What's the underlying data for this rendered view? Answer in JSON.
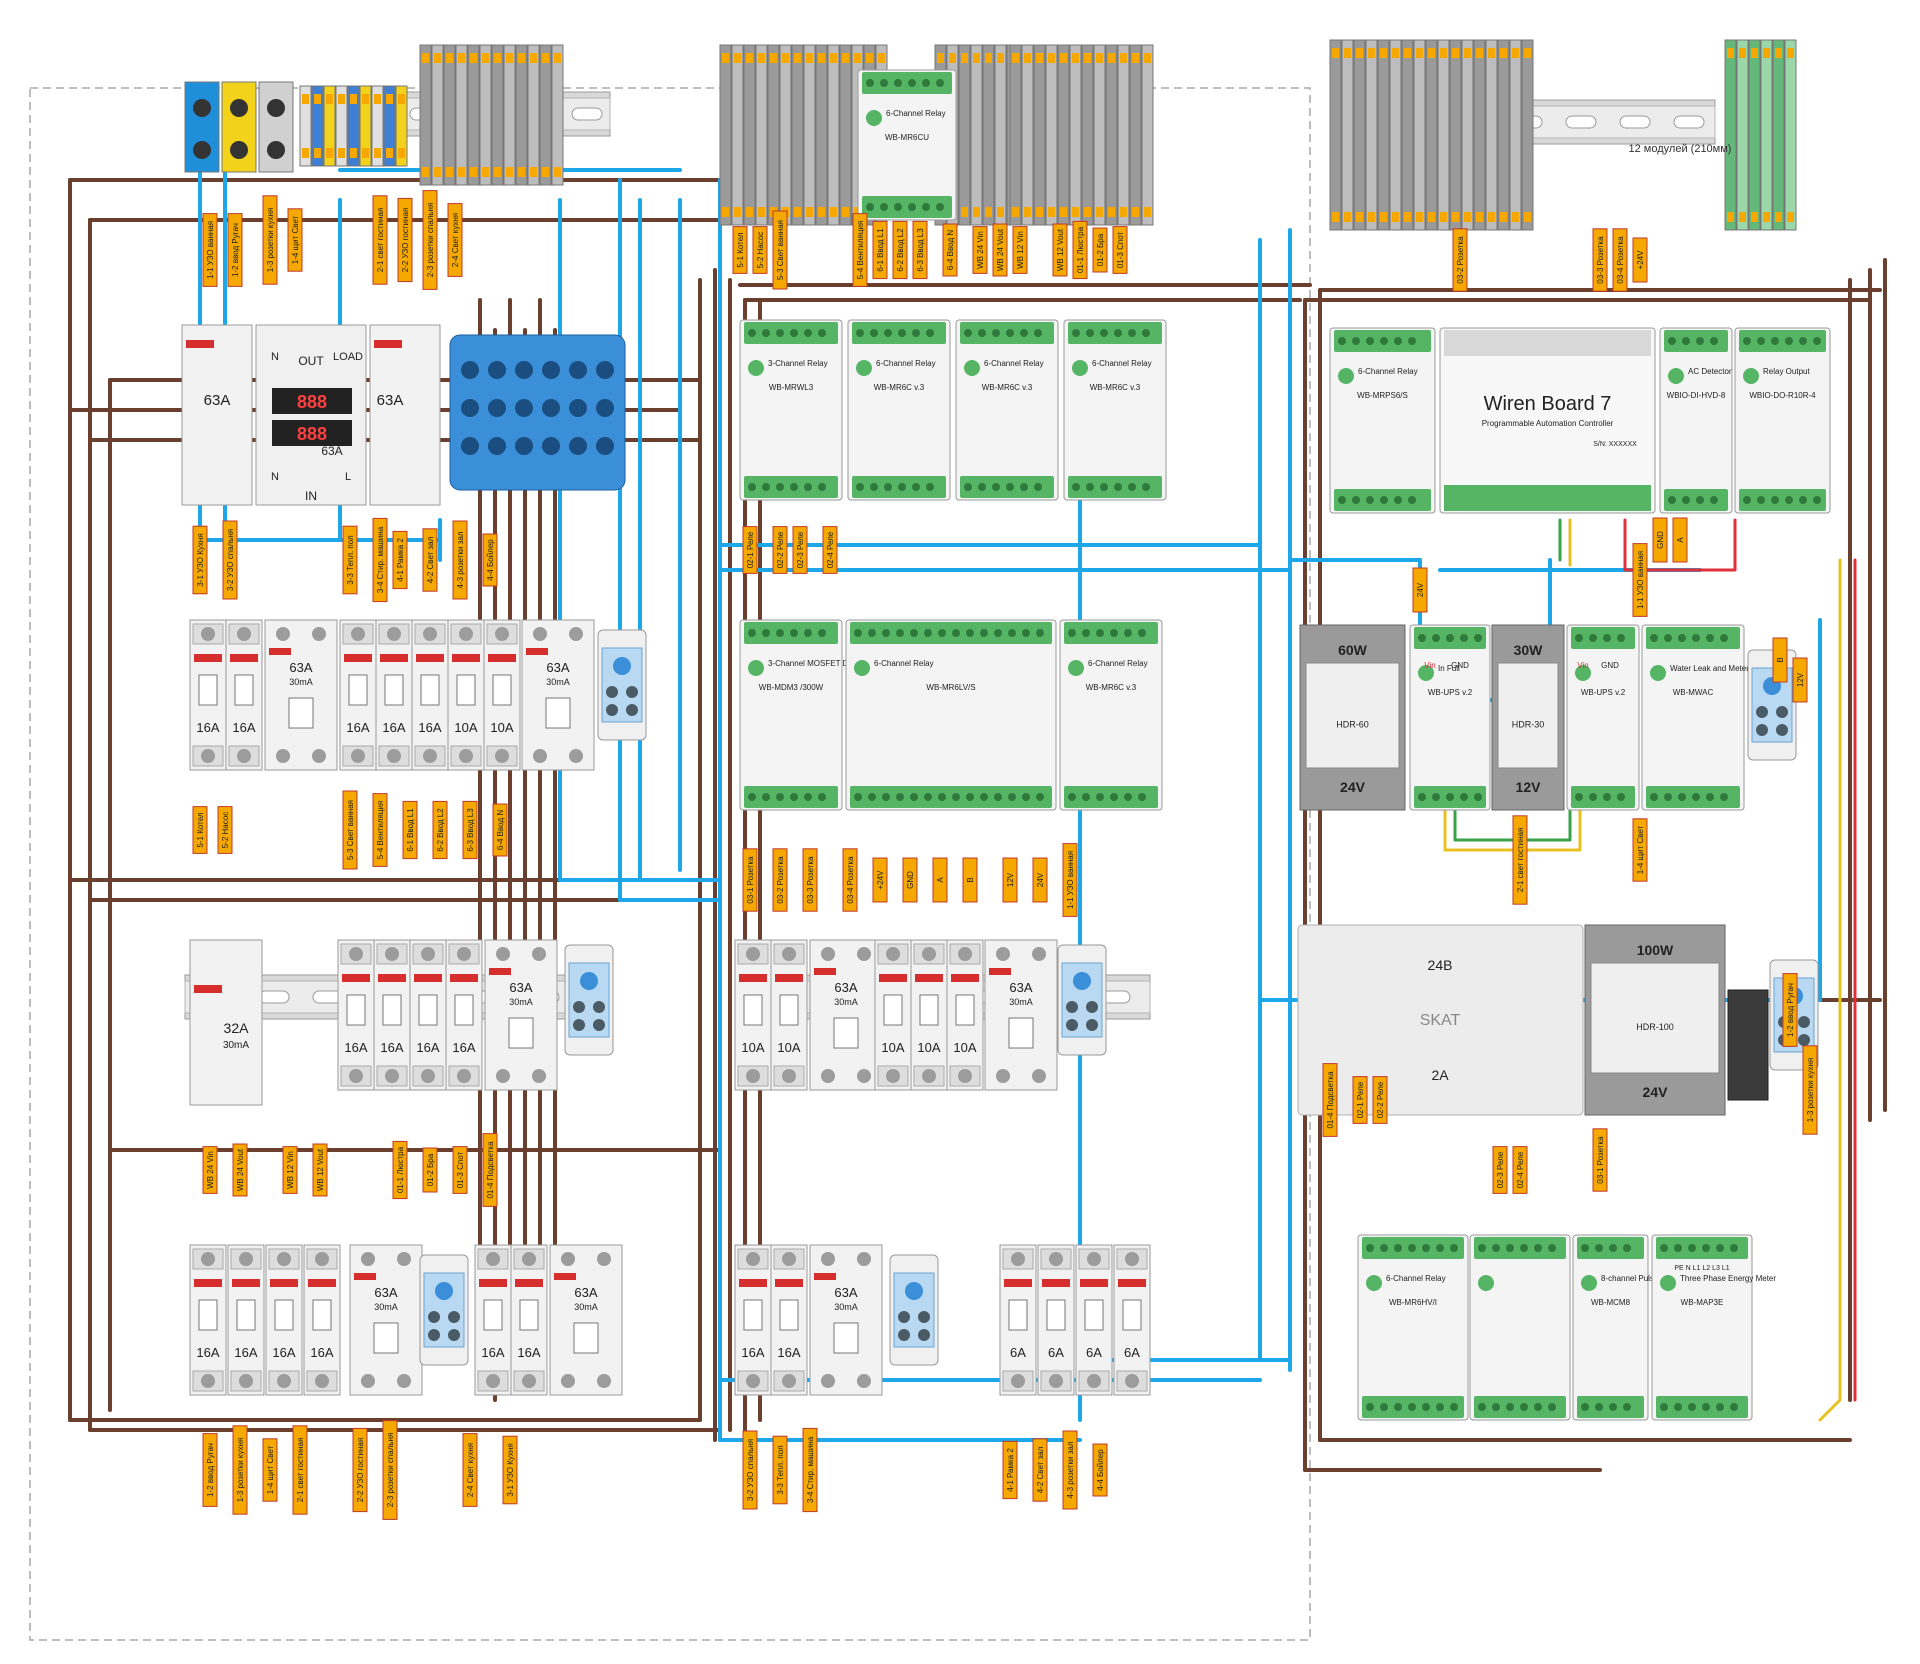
{
  "rail_label": "12 модулей (210мм)",
  "colors": {
    "wire_brown": "#6b3f2e",
    "wire_blue": "#1ea7e8",
    "wire_red": "#e0303a",
    "wire_yellow": "#e8c020",
    "wire_green": "#3aa34a",
    "label_bg": "#f5a800",
    "label_border": "#c0392b",
    "device_body": "#ececec",
    "device_edge": "#9a9a9a",
    "terminal_green": "#55b565",
    "block_blue": "#3a8fd8",
    "psu_grey": "#8a8a8a",
    "ekf_red": "#d62d2d"
  },
  "left_panel": {
    "main_breaker_left": "63A",
    "main_breaker_right": "63A",
    "meter": {
      "out": "OUT",
      "load": "LOAD",
      "n": "N",
      "in": "IN",
      "l": "L",
      "rating": "63A",
      "digits": "888"
    },
    "row2": {
      "breakers": [
        "16A",
        "16A",
        "16A",
        "16A",
        "16A",
        "10A",
        "10A"
      ],
      "rcd": [
        {
          "rating": "63A",
          "sub": "30mA"
        },
        {
          "rating": "63A",
          "sub": "30mA"
        }
      ]
    },
    "row3": {
      "rcbo": {
        "rating": "32A",
        "sub": "30mA"
      },
      "breakers": [
        "16A",
        "16A",
        "16A",
        "16A"
      ],
      "rcd": {
        "rating": "63A",
        "sub": "30mA"
      }
    },
    "row4": {
      "breakers": [
        "16A",
        "16A",
        "16A",
        "16A",
        "16A",
        "16A"
      ],
      "rcd": [
        {
          "rating": "63A",
          "sub": "30mA"
        },
        {
          "rating": "63A",
          "sub": "30mA"
        }
      ]
    }
  },
  "middle_panel": {
    "top_relay": {
      "title": "6-Channel Relay",
      "model": "WB-MR6CU"
    },
    "row1": [
      {
        "title": "3-Channel Relay",
        "model": "WB-MRWL3"
      },
      {
        "title": "6-Channel Relay",
        "model": "WB-MR6C v.3"
      },
      {
        "title": "6-Channel Relay",
        "model": "WB-MR6C v.3"
      },
      {
        "title": "6-Channel Relay",
        "model": "WB-MR6C v.3"
      }
    ],
    "row2": [
      {
        "title": "3-Channel MOSFET Dimmer",
        "model": "WB-MDM3 /300W"
      },
      {
        "title": "6-Channel Relay",
        "model": "WB-MR6LV/S"
      },
      {
        "title": "6-Channel Relay",
        "model": "WB-MR6C v.3"
      }
    ],
    "row3": {
      "breakers": [
        "10A",
        "10A",
        "10A",
        "10A",
        "10A"
      ],
      "rcd": [
        {
          "rating": "63A",
          "sub": "30mA"
        },
        {
          "rating": "63A",
          "sub": "30mA"
        }
      ]
    },
    "row4": {
      "breakers": [
        "16A",
        "16A",
        "6A",
        "6A",
        "6A",
        "6A"
      ],
      "rcd": {
        "rating": "63A",
        "sub": "30mA"
      }
    }
  },
  "right_panel": {
    "relay_left": {
      "title": "6-Channel Relay",
      "model": "WB-MRPS6/S"
    },
    "controller": {
      "title": "Wiren Board 7",
      "subtitle": "Programmable Automation Controller",
      "serial": "S/N: XXXXXX"
    },
    "ac_detector": {
      "title": "AC Detector",
      "model": "WBIO-DI-HVD-8"
    },
    "relay_output": {
      "title": "Relay Output",
      "model": "WBIO-DO-R10R-4"
    },
    "psu60": {
      "power": "60W",
      "model": "HDR-60",
      "voltage": "24V"
    },
    "ups1": {
      "model": "WB-UPS v.2",
      "vin": "Vin",
      "gnd": "GND",
      "st1": "In Full",
      "st2": "Charge",
      "st3": "Full"
    },
    "psu30": {
      "power": "30W",
      "model": "HDR-30",
      "voltage": "12V"
    },
    "ups2": {
      "model": "WB-UPS v.2",
      "vin": "Vin",
      "gnd": "GND"
    },
    "water": {
      "title": "Water Leak and Meters Controller",
      "model": "WB-MWAC"
    },
    "skat": {
      "top": "24В",
      "brand": "SKAT",
      "bottom": "2A"
    },
    "psu100": {
      "power": "100W",
      "model": "HDR-100",
      "voltage": "24V"
    },
    "relay_hv": {
      "title": "6-Channel Relay",
      "model": "WB-MR6HV/I"
    },
    "pulse": {
      "title": "8-channel Pulse Counter",
      "model": "WB-MCM8"
    },
    "meter3": {
      "title": "Three Phase Energy Meter",
      "model": "WB-MAP3E",
      "labels": "PE N L1 L2 L3 L1"
    }
  },
  "wire_tags": [
    "1-1 УЗО ванная",
    "1-2 ввод Ругач",
    "1-3 розетки кухня",
    "1-4 щит Свет",
    "2-1 свет гостиная",
    "2-2 УЗО гостиная",
    "2-3 розетки спальня",
    "2-4 Свет кухня",
    "3-1 УЗО Кухня",
    "3-2 УЗО спальня",
    "3-3 Тепл. пол",
    "3-4 Стир. машина",
    "4-1 Рамка 2",
    "4-2 Свет зал",
    "4-3 розетки зал",
    "4-4 Бойлер",
    "5-1 Котел",
    "5-2 Насос",
    "5-3 Свет ванная",
    "5-4 Вентиляция",
    "6-1 Ввод L1",
    "6-2 Ввод L2",
    "6-3 Ввод L3",
    "6-4 Ввод N",
    "WB 24 Vin",
    "WB 24 Vout",
    "WB 12 Vin",
    "WB 12 Vout",
    "01-1 Люстра",
    "01-2 Бра",
    "01-3 Спот",
    "01-4 Подсветка",
    "02-1 Реле",
    "02-2 Реле",
    "02-3 Реле",
    "02-4 Реле",
    "03-1 Розетка",
    "03-2 Розетка",
    "03-3 Розетка",
    "03-4 Розетка",
    "+24V",
    "GND",
    "A",
    "B",
    "12V",
    "24V"
  ]
}
